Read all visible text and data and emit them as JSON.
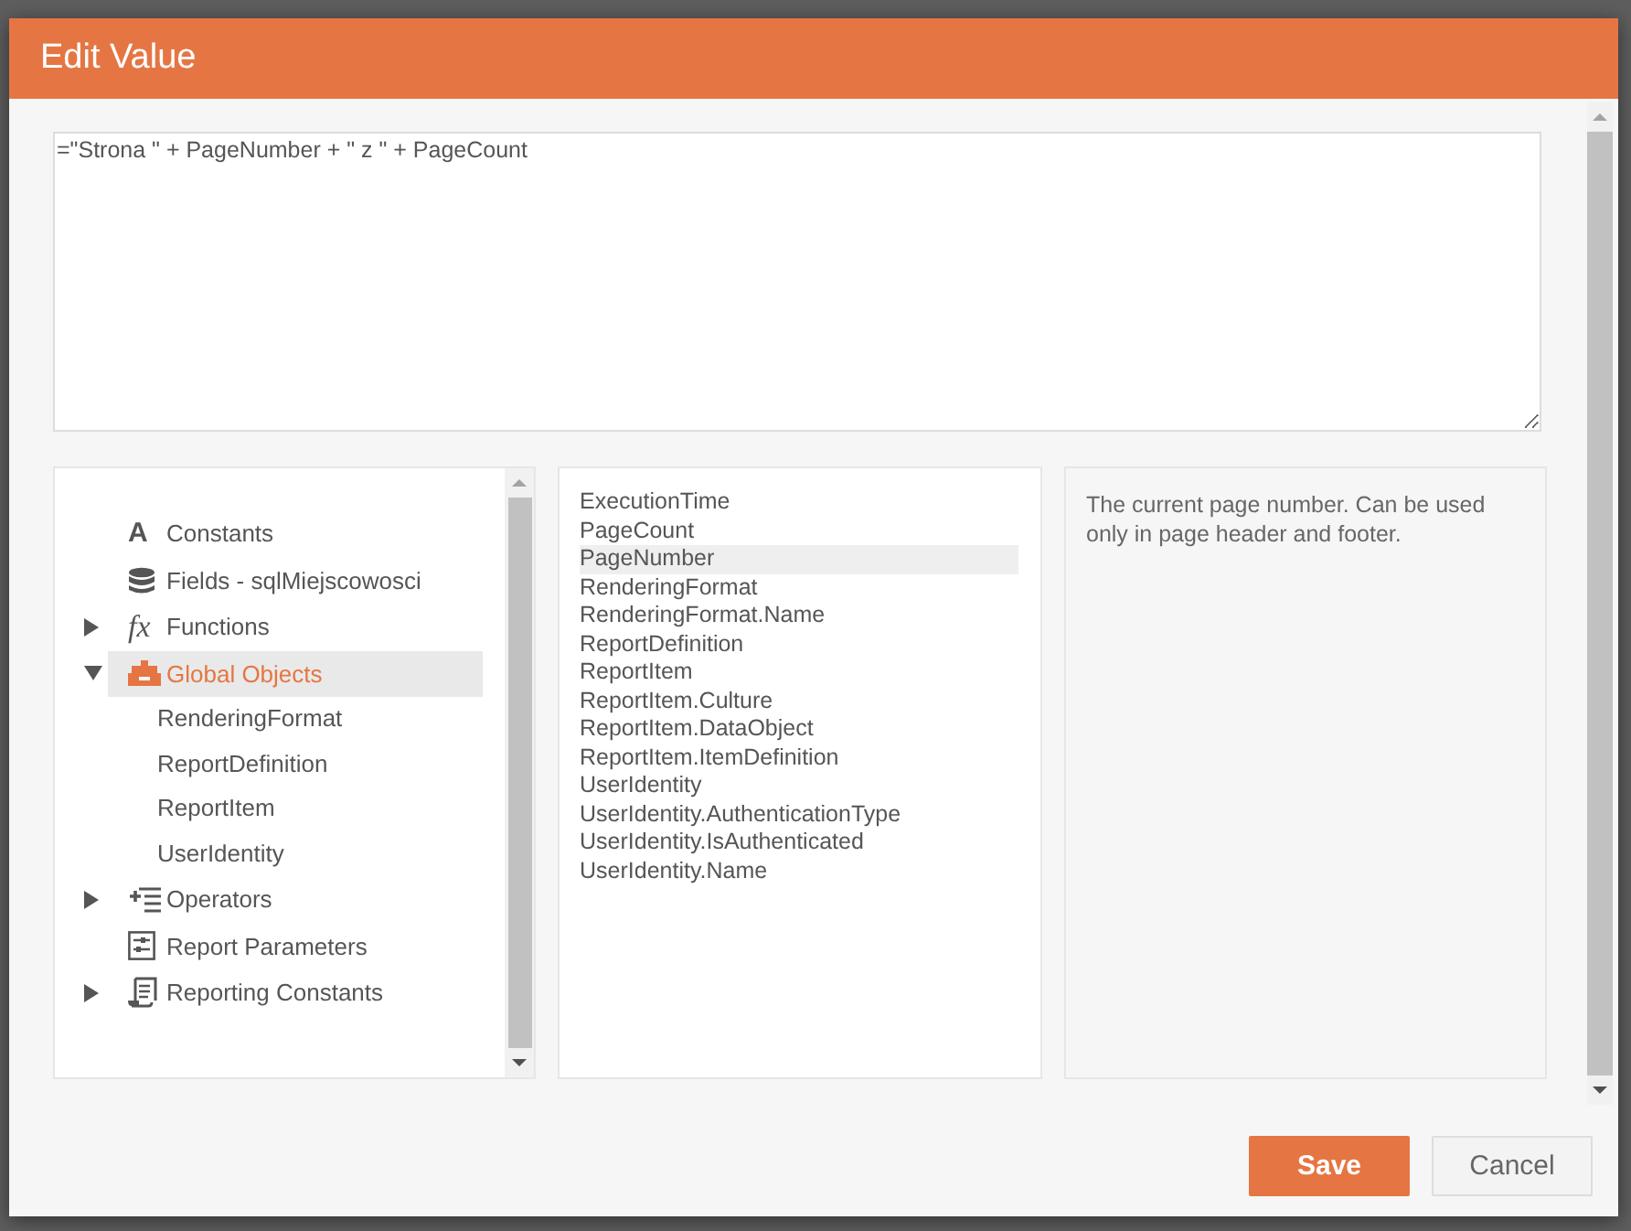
{
  "dialog": {
    "title": "Edit Value"
  },
  "expression": {
    "value": "=\"Strona \" + PageNumber + \" z \" + PageCount"
  },
  "tree": {
    "items": [
      {
        "label": "Constants",
        "kind": "constants",
        "glyph": "A",
        "selected": false
      },
      {
        "label": "Fields - sqlMiejscowosci",
        "kind": "fields",
        "selected": false
      },
      {
        "label": "Functions",
        "kind": "functions",
        "glyph": "fx",
        "expanded": false,
        "selected": false
      },
      {
        "label": "Global Objects",
        "kind": "objects",
        "expanded": true,
        "selected": true,
        "children": [
          {
            "label": "RenderingFormat",
            "selected": false
          },
          {
            "label": "ReportDefinition",
            "selected": false
          },
          {
            "label": "ReportItem",
            "selected": false
          },
          {
            "label": "UserIdentity",
            "selected": false
          }
        ]
      },
      {
        "label": "Operators",
        "kind": "operators",
        "expanded": false,
        "selected": false
      },
      {
        "label": "Report Parameters",
        "kind": "parameters",
        "selected": false
      },
      {
        "label": "Reporting Constants",
        "kind": "reporting",
        "expanded": false,
        "selected": false
      }
    ]
  },
  "members": [
    {
      "label": "ExecutionTime",
      "selected": false
    },
    {
      "label": "PageCount",
      "selected": false
    },
    {
      "label": "PageNumber",
      "selected": true
    },
    {
      "label": "RenderingFormat",
      "selected": false
    },
    {
      "label": "RenderingFormat.Name",
      "selected": false
    },
    {
      "label": "ReportDefinition",
      "selected": false
    },
    {
      "label": "ReportItem",
      "selected": false
    },
    {
      "label": "ReportItem.Culture",
      "selected": false
    },
    {
      "label": "ReportItem.DataObject",
      "selected": false
    },
    {
      "label": "ReportItem.ItemDefinition",
      "selected": false
    },
    {
      "label": "UserIdentity",
      "selected": false
    },
    {
      "label": "UserIdentity.AuthenticationType",
      "selected": false
    },
    {
      "label": "UserIdentity.IsAuthenticated",
      "selected": false
    },
    {
      "label": "UserIdentity.Name",
      "selected": false
    }
  ],
  "description": "The current page number. Can be used only in page header and footer.",
  "buttons": [
    {
      "label": "Save",
      "kind": "primary"
    },
    {
      "label": "Cancel",
      "kind": "secondary"
    }
  ]
}
